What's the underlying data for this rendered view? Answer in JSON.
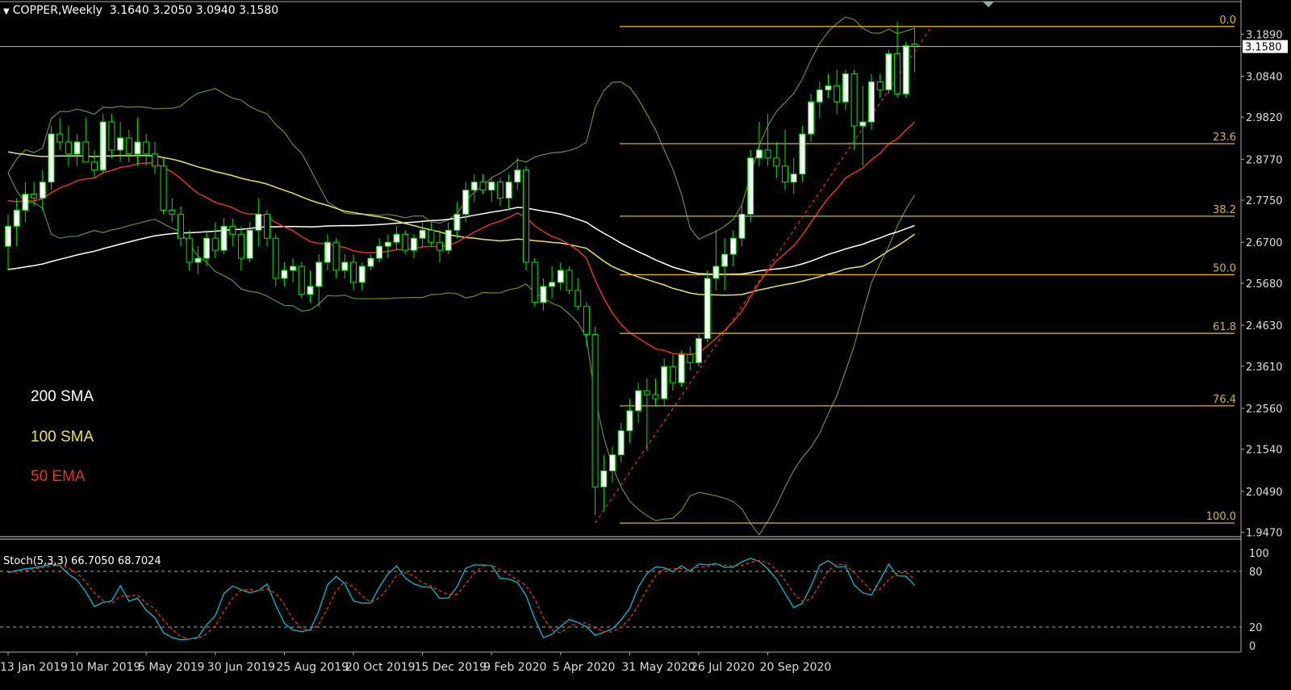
{
  "header": {
    "symbol": "COPPER,Weekly",
    "ohlc": "3.1640 3.2050 3.0940 3.1580"
  },
  "legend": [
    {
      "label": "200 SMA",
      "color": "#ffffff"
    },
    {
      "label": "100 SMA",
      "color": "#e6e64d"
    },
    {
      "label": "50 EMA",
      "color": "#e0341e"
    }
  ],
  "stoch": {
    "title": "Stoch(5,3,3) 66.7050 68.7024"
  },
  "colors": {
    "background": "#000000",
    "bull_candle": "#ffffff",
    "bear_candle": "#000000",
    "wick": "#00e600",
    "fib": "#d9b330",
    "bollinger": "#6b8e23",
    "sma200": "#ffffff",
    "sma100": "#e6e64d",
    "ema50": "#e0341e",
    "stoch_main": "#00bcd4",
    "stoch_signal": "#e0341e",
    "current_price_line": "#b0c4de"
  },
  "chart_data": {
    "type": "candlestick",
    "symbol": "COPPER",
    "timeframe": "Weekly",
    "last_ohlc": {
      "open": 3.164,
      "high": 3.205,
      "low": 3.094,
      "close": 3.158
    },
    "current_price": 3.158,
    "current_price_label": "3.1580",
    "y_axis_labels": [
      "3.1890",
      "3.0840",
      "2.9820",
      "2.8770",
      "2.7750",
      "2.6700",
      "2.5680",
      "2.4630",
      "2.3610",
      "2.2560",
      "2.1540",
      "2.0490",
      "1.9470"
    ],
    "y_axis_values": [
      3.189,
      3.084,
      2.982,
      2.877,
      2.775,
      2.67,
      2.568,
      2.463,
      2.361,
      2.256,
      2.154,
      2.049,
      1.947
    ],
    "ylim": [
      1.94,
      3.27
    ],
    "x_axis_labels": [
      "13 Jan 2019",
      "10 Mar 2019",
      "5 May 2019",
      "30 Jun 2019",
      "25 Aug 2019",
      "20 Oct 2019",
      "15 Dec 2019",
      "9 Feb 2020",
      "5 Apr 2020",
      "31 May 2020",
      "26 Jul 2020",
      "20 Sep 2020"
    ],
    "x_axis_label_weeks": [
      0,
      8,
      16,
      24,
      32,
      40,
      48,
      56,
      64,
      72,
      80,
      88
    ],
    "candles": [
      {
        "o": 2.66,
        "h": 2.74,
        "l": 2.6,
        "c": 2.71
      },
      {
        "o": 2.71,
        "h": 2.78,
        "l": 2.66,
        "c": 2.75
      },
      {
        "o": 2.75,
        "h": 2.82,
        "l": 2.72,
        "c": 2.79
      },
      {
        "o": 2.79,
        "h": 2.82,
        "l": 2.76,
        "c": 2.78
      },
      {
        "o": 2.78,
        "h": 2.85,
        "l": 2.75,
        "c": 2.82
      },
      {
        "o": 2.82,
        "h": 2.96,
        "l": 2.8,
        "c": 2.94
      },
      {
        "o": 2.94,
        "h": 2.98,
        "l": 2.9,
        "c": 2.92
      },
      {
        "o": 2.92,
        "h": 2.96,
        "l": 2.86,
        "c": 2.89
      },
      {
        "o": 2.89,
        "h": 2.94,
        "l": 2.86,
        "c": 2.92
      },
      {
        "o": 2.92,
        "h": 2.98,
        "l": 2.88,
        "c": 2.87
      },
      {
        "o": 2.87,
        "h": 2.9,
        "l": 2.83,
        "c": 2.85
      },
      {
        "o": 2.85,
        "h": 2.99,
        "l": 2.84,
        "c": 2.97
      },
      {
        "o": 2.97,
        "h": 2.99,
        "l": 2.88,
        "c": 2.9
      },
      {
        "o": 2.9,
        "h": 2.97,
        "l": 2.87,
        "c": 2.93
      },
      {
        "o": 2.93,
        "h": 2.95,
        "l": 2.87,
        "c": 2.89
      },
      {
        "o": 2.89,
        "h": 2.98,
        "l": 2.86,
        "c": 2.92
      },
      {
        "o": 2.92,
        "h": 2.94,
        "l": 2.86,
        "c": 2.89
      },
      {
        "o": 2.89,
        "h": 2.92,
        "l": 2.84,
        "c": 2.86
      },
      {
        "o": 2.86,
        "h": 2.88,
        "l": 2.74,
        "c": 2.75
      },
      {
        "o": 2.75,
        "h": 2.78,
        "l": 2.72,
        "c": 2.74
      },
      {
        "o": 2.74,
        "h": 2.76,
        "l": 2.66,
        "c": 2.68
      },
      {
        "o": 2.68,
        "h": 2.7,
        "l": 2.6,
        "c": 2.62
      },
      {
        "o": 2.62,
        "h": 2.66,
        "l": 2.59,
        "c": 2.63
      },
      {
        "o": 2.63,
        "h": 2.7,
        "l": 2.61,
        "c": 2.68
      },
      {
        "o": 2.68,
        "h": 2.72,
        "l": 2.63,
        "c": 2.65
      },
      {
        "o": 2.65,
        "h": 2.73,
        "l": 2.64,
        "c": 2.71
      },
      {
        "o": 2.71,
        "h": 2.73,
        "l": 2.66,
        "c": 2.69
      },
      {
        "o": 2.69,
        "h": 2.71,
        "l": 2.6,
        "c": 2.63
      },
      {
        "o": 2.63,
        "h": 2.72,
        "l": 2.62,
        "c": 2.7
      },
      {
        "o": 2.7,
        "h": 2.78,
        "l": 2.66,
        "c": 2.74
      },
      {
        "o": 2.74,
        "h": 2.75,
        "l": 2.66,
        "c": 2.68
      },
      {
        "o": 2.68,
        "h": 2.69,
        "l": 2.56,
        "c": 2.58
      },
      {
        "o": 2.58,
        "h": 2.62,
        "l": 2.56,
        "c": 2.6
      },
      {
        "o": 2.6,
        "h": 2.63,
        "l": 2.57,
        "c": 2.61
      },
      {
        "o": 2.61,
        "h": 2.62,
        "l": 2.53,
        "c": 2.54
      },
      {
        "o": 2.54,
        "h": 2.6,
        "l": 2.52,
        "c": 2.56
      },
      {
        "o": 2.56,
        "h": 2.64,
        "l": 2.51,
        "c": 2.62
      },
      {
        "o": 2.62,
        "h": 2.69,
        "l": 2.6,
        "c": 2.67
      },
      {
        "o": 2.67,
        "h": 2.68,
        "l": 2.58,
        "c": 2.6
      },
      {
        "o": 2.6,
        "h": 2.64,
        "l": 2.58,
        "c": 2.62
      },
      {
        "o": 2.62,
        "h": 2.64,
        "l": 2.55,
        "c": 2.57
      },
      {
        "o": 2.57,
        "h": 2.62,
        "l": 2.55,
        "c": 2.61
      },
      {
        "o": 2.61,
        "h": 2.64,
        "l": 2.6,
        "c": 2.63
      },
      {
        "o": 2.63,
        "h": 2.68,
        "l": 2.62,
        "c": 2.66
      },
      {
        "o": 2.66,
        "h": 2.69,
        "l": 2.63,
        "c": 2.67
      },
      {
        "o": 2.67,
        "h": 2.71,
        "l": 2.65,
        "c": 2.69
      },
      {
        "o": 2.69,
        "h": 2.7,
        "l": 2.64,
        "c": 2.65
      },
      {
        "o": 2.65,
        "h": 2.69,
        "l": 2.63,
        "c": 2.68
      },
      {
        "o": 2.68,
        "h": 2.72,
        "l": 2.66,
        "c": 2.7
      },
      {
        "o": 2.7,
        "h": 2.72,
        "l": 2.66,
        "c": 2.67
      },
      {
        "o": 2.67,
        "h": 2.7,
        "l": 2.62,
        "c": 2.65
      },
      {
        "o": 2.65,
        "h": 2.72,
        "l": 2.64,
        "c": 2.7
      },
      {
        "o": 2.7,
        "h": 2.77,
        "l": 2.68,
        "c": 2.74
      },
      {
        "o": 2.74,
        "h": 2.82,
        "l": 2.72,
        "c": 2.8
      },
      {
        "o": 2.8,
        "h": 2.84,
        "l": 2.77,
        "c": 2.82
      },
      {
        "o": 2.82,
        "h": 2.84,
        "l": 2.79,
        "c": 2.8
      },
      {
        "o": 2.8,
        "h": 2.83,
        "l": 2.77,
        "c": 2.82
      },
      {
        "o": 2.82,
        "h": 2.83,
        "l": 2.76,
        "c": 2.78
      },
      {
        "o": 2.78,
        "h": 2.84,
        "l": 2.75,
        "c": 2.82
      },
      {
        "o": 2.82,
        "h": 2.88,
        "l": 2.8,
        "c": 2.85
      },
      {
        "o": 2.85,
        "h": 2.86,
        "l": 2.6,
        "c": 2.62
      },
      {
        "o": 2.62,
        "h": 2.63,
        "l": 2.51,
        "c": 2.52
      },
      {
        "o": 2.52,
        "h": 2.58,
        "l": 2.5,
        "c": 2.56
      },
      {
        "o": 2.56,
        "h": 2.61,
        "l": 2.53,
        "c": 2.57
      },
      {
        "o": 2.57,
        "h": 2.62,
        "l": 2.55,
        "c": 2.6
      },
      {
        "o": 2.6,
        "h": 2.61,
        "l": 2.54,
        "c": 2.55
      },
      {
        "o": 2.55,
        "h": 2.58,
        "l": 2.5,
        "c": 2.51
      },
      {
        "o": 2.51,
        "h": 2.52,
        "l": 2.41,
        "c": 2.44
      },
      {
        "o": 2.44,
        "h": 2.46,
        "l": 1.99,
        "c": 2.06
      },
      {
        "o": 2.06,
        "h": 2.14,
        "l": 2.0,
        "c": 2.1
      },
      {
        "o": 2.1,
        "h": 2.16,
        "l": 2.07,
        "c": 2.14
      },
      {
        "o": 2.14,
        "h": 2.22,
        "l": 2.12,
        "c": 2.2
      },
      {
        "o": 2.2,
        "h": 2.28,
        "l": 2.17,
        "c": 2.25
      },
      {
        "o": 2.25,
        "h": 2.32,
        "l": 2.22,
        "c": 2.3
      },
      {
        "o": 2.3,
        "h": 2.33,
        "l": 2.15,
        "c": 2.29
      },
      {
        "o": 2.29,
        "h": 2.33,
        "l": 2.26,
        "c": 2.28
      },
      {
        "o": 2.28,
        "h": 2.38,
        "l": 2.26,
        "c": 2.36
      },
      {
        "o": 2.36,
        "h": 2.39,
        "l": 2.3,
        "c": 2.32
      },
      {
        "o": 2.32,
        "h": 2.4,
        "l": 2.31,
        "c": 2.39
      },
      {
        "o": 2.39,
        "h": 2.41,
        "l": 2.35,
        "c": 2.37
      },
      {
        "o": 2.37,
        "h": 2.44,
        "l": 2.36,
        "c": 2.43
      },
      {
        "o": 2.43,
        "h": 2.6,
        "l": 2.42,
        "c": 2.58
      },
      {
        "o": 2.58,
        "h": 2.7,
        "l": 2.55,
        "c": 2.61
      },
      {
        "o": 2.61,
        "h": 2.68,
        "l": 2.55,
        "c": 2.64
      },
      {
        "o": 2.64,
        "h": 2.7,
        "l": 2.61,
        "c": 2.68
      },
      {
        "o": 2.68,
        "h": 2.76,
        "l": 2.66,
        "c": 2.74
      },
      {
        "o": 2.74,
        "h": 2.9,
        "l": 2.72,
        "c": 2.88
      },
      {
        "o": 2.88,
        "h": 2.97,
        "l": 2.86,
        "c": 2.9
      },
      {
        "o": 2.9,
        "h": 2.99,
        "l": 2.86,
        "c": 2.88
      },
      {
        "o": 2.88,
        "h": 2.92,
        "l": 2.83,
        "c": 2.86
      },
      {
        "o": 2.86,
        "h": 2.95,
        "l": 2.8,
        "c": 2.82
      },
      {
        "o": 2.82,
        "h": 2.88,
        "l": 2.79,
        "c": 2.84
      },
      {
        "o": 2.84,
        "h": 2.96,
        "l": 2.82,
        "c": 2.94
      },
      {
        "o": 2.94,
        "h": 3.04,
        "l": 2.92,
        "c": 3.02
      },
      {
        "o": 3.02,
        "h": 3.07,
        "l": 2.98,
        "c": 3.05
      },
      {
        "o": 3.05,
        "h": 3.09,
        "l": 3.03,
        "c": 3.06
      },
      {
        "o": 3.06,
        "h": 3.1,
        "l": 2.99,
        "c": 3.02
      },
      {
        "o": 3.02,
        "h": 3.1,
        "l": 3.0,
        "c": 3.09
      },
      {
        "o": 3.09,
        "h": 3.1,
        "l": 2.9,
        "c": 2.96
      },
      {
        "o": 2.96,
        "h": 3.06,
        "l": 2.86,
        "c": 2.97
      },
      {
        "o": 2.97,
        "h": 3.09,
        "l": 2.95,
        "c": 3.07
      },
      {
        "o": 3.07,
        "h": 3.09,
        "l": 3.03,
        "c": 3.05
      },
      {
        "o": 3.05,
        "h": 3.15,
        "l": 3.04,
        "c": 3.14
      },
      {
        "o": 3.14,
        "h": 3.22,
        "l": 3.03,
        "c": 3.04
      },
      {
        "o": 3.04,
        "h": 3.17,
        "l": 3.03,
        "c": 3.16
      },
      {
        "o": 3.164,
        "h": 3.205,
        "l": 3.094,
        "c": 3.158
      }
    ],
    "fibonacci": {
      "high": 3.208,
      "low": 1.97,
      "levels": [
        {
          "label": "0.0",
          "ratio": 0.0
        },
        {
          "label": "23.6",
          "ratio": 0.236
        },
        {
          "label": "38.2",
          "ratio": 0.382
        },
        {
          "label": "50.0",
          "ratio": 0.5
        },
        {
          "label": "61.8",
          "ratio": 0.618
        },
        {
          "label": "76.4",
          "ratio": 0.764
        },
        {
          "label": "100.0",
          "ratio": 1.0
        }
      ]
    },
    "indicators": [
      "200 SMA",
      "100 SMA",
      "50 EMA",
      "Bollinger Bands"
    ],
    "stochastic": {
      "params": "5,3,3",
      "main": 66.705,
      "signal": 68.7024,
      "levels_labels": [
        "100",
        "80",
        "20",
        "0"
      ],
      "levels": [
        100,
        80,
        20,
        0
      ]
    }
  }
}
